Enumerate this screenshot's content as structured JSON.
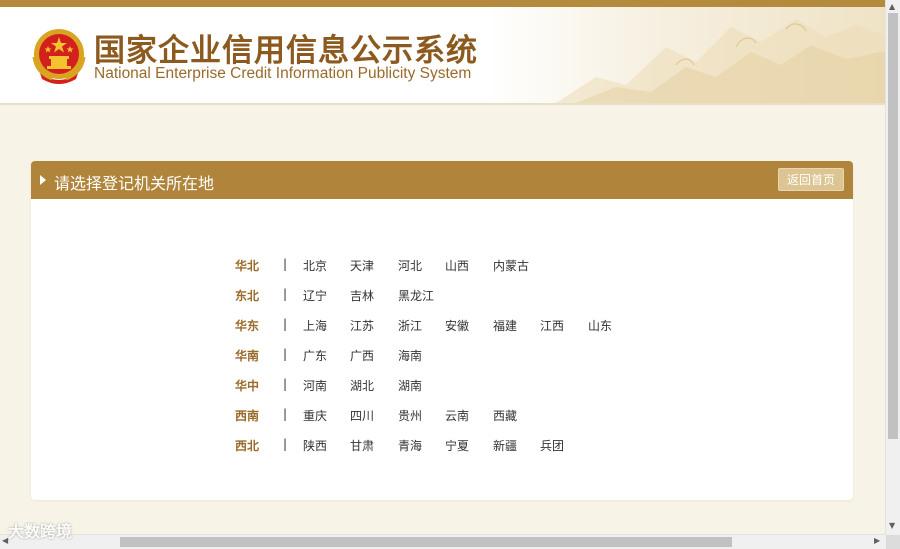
{
  "header": {
    "title_cn": "国家企业信用信息公示系统",
    "title_en": "National Enterprise Credit Information Publicity System"
  },
  "panel": {
    "title": "请选择登记机关所在地",
    "home_button": "返回首页"
  },
  "regions": [
    {
      "name": "华北",
      "separator": "|",
      "provinces": [
        "北京",
        "天津",
        "河北",
        "山西",
        "内蒙古"
      ]
    },
    {
      "name": "东北",
      "separator": "|",
      "provinces": [
        "辽宁",
        "吉林",
        "黑龙江"
      ]
    },
    {
      "name": "华东",
      "separator": "|",
      "provinces": [
        "上海",
        "江苏",
        "浙江",
        "安徽",
        "福建",
        "江西",
        "山东"
      ]
    },
    {
      "name": "华南",
      "separator": "|",
      "provinces": [
        "广东",
        "广西",
        "海南"
      ]
    },
    {
      "name": "华中",
      "separator": "|",
      "provinces": [
        "河南",
        "湖北",
        "湖南"
      ]
    },
    {
      "name": "西南",
      "separator": "|",
      "provinces": [
        "重庆",
        "四川",
        "贵州",
        "云南",
        "西藏"
      ]
    },
    {
      "name": "西北",
      "separator": "|",
      "provinces": [
        "陕西",
        "甘肃",
        "青海",
        "宁夏",
        "新疆",
        "兵团"
      ]
    }
  ],
  "watermark": "大数跨境",
  "colors": {
    "accent": "#b0843a",
    "title": "#8c5a1e",
    "background": "#f7f3e6"
  },
  "icons": {
    "emblem": "national-emblem-icon",
    "arrow": "caret-right-icon"
  }
}
